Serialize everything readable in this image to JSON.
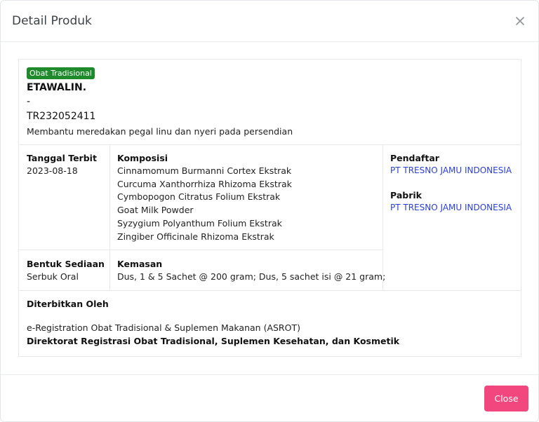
{
  "modal": {
    "title": "Detail Produk",
    "close_icon": "close-icon",
    "close_button_label": "Close"
  },
  "product": {
    "category_badge": "Obat Tradisional",
    "name": "ETAWALIN.",
    "separator": "-",
    "registration_number": "TR232052411",
    "claim": "Membantu meredakan pegal linu dan nyeri pada persendian"
  },
  "details": {
    "issue_date_label": "Tanggal Terbit",
    "issue_date": "2023-08-18",
    "composition_label": "Komposisi",
    "composition": [
      "Cinnamomum Burmanni Cortex Ekstrak",
      "Curcuma Xanthorrhiza Rhizoma Ekstrak",
      "Cymbopogon Citratus Folium Ekstrak",
      "Goat Milk Powder",
      "Syzygium Polyanthum Folium Ekstrak",
      "Zingiber Officinale Rhizoma Ekstrak"
    ],
    "registrant_label": "Pendaftar",
    "registrant": "PT TRESNO JAMU INDONESIA",
    "factory_label": "Pabrik",
    "factory": "PT TRESNO JAMU INDONESIA",
    "dosage_form_label": "Bentuk Sediaan",
    "dosage_form": "Serbuk Oral",
    "packaging_label": "Kemasan",
    "packaging": "Dus, 1 & 5 Sachet @ 200 gram; Dus, 5 sachet isi @ 21 gram;"
  },
  "publisher": {
    "label": "Diterbitkan Oleh",
    "system": "e-Registration Obat Tradisional & Suplemen Makanan (ASROT)",
    "directorate": "Direktorat Registrasi Obat Tradisional, Suplemen Kesehatan, dan Kosmetik"
  },
  "colors": {
    "badge": "#1f8a2c",
    "link": "#2a3fd8",
    "close_button": "#f2467e"
  }
}
